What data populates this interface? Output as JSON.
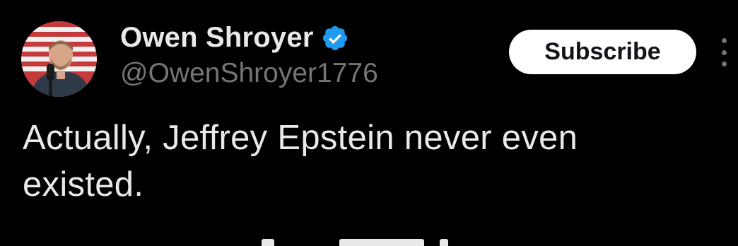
{
  "post": {
    "author": {
      "display_name": "Owen Shroyer",
      "handle": "@OwenShroyer1776",
      "verified": true,
      "verified_color": "#1d9bf0",
      "avatar_icon": "profile-photo"
    },
    "subscribe_label": "Subscribe",
    "more_icon": "more-vertical-icon",
    "text_lines": [
      "Actually, Jeffrey Epstein never even",
      "existed."
    ]
  },
  "colors": {
    "background": "#000000",
    "primary_text": "#e7e9ea",
    "secondary_text": "#71767b",
    "button_bg": "#ffffff",
    "button_text": "#0f1419"
  }
}
